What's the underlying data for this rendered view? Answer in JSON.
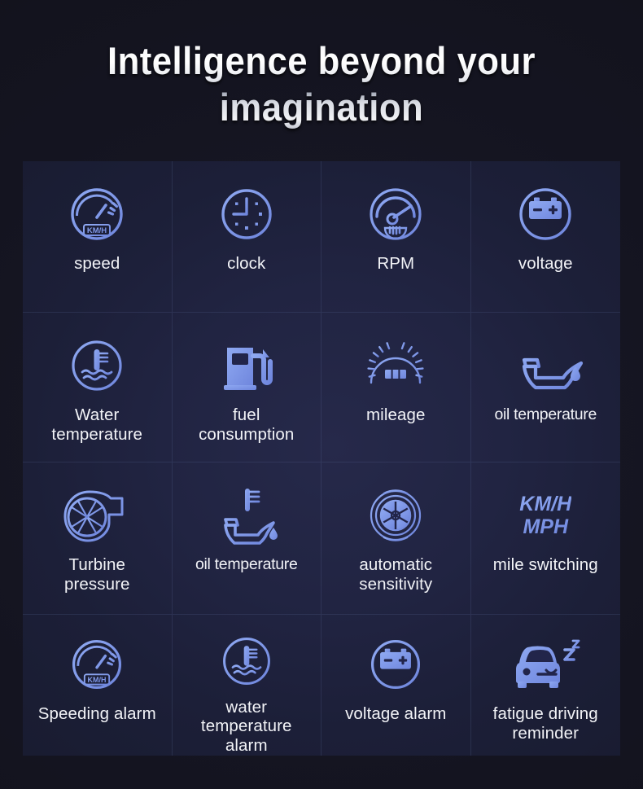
{
  "header": {
    "title": "Intelligence beyond your imagination"
  },
  "colors": {
    "page_background": "#13131d",
    "grid_background": "#222543",
    "icon_gradient_start": "#8fa9f2",
    "icon_gradient_end": "#6f86dd",
    "label_text": "#f2f3f7",
    "divider": "#5a659a"
  },
  "features": [
    {
      "label": "speed",
      "icon": "speedometer-kmh-icon"
    },
    {
      "label": "clock",
      "icon": "clock-icon"
    },
    {
      "label": "RPM",
      "icon": "rpm-gauge-icon"
    },
    {
      "label": "voltage",
      "icon": "battery-icon"
    },
    {
      "label": "Water\ntemperature",
      "icon": "water-temperature-icon"
    },
    {
      "label": "fuel\nconsumption",
      "icon": "fuel-pump-icon"
    },
    {
      "label": "mileage",
      "icon": "odometer-icon"
    },
    {
      "label": "oil temperature",
      "icon": "oil-can-icon"
    },
    {
      "label": "Turbine\npressure",
      "icon": "turbocharger-icon"
    },
    {
      "label": "oil temperature",
      "icon": "oil-can-thermometer-icon"
    },
    {
      "label": "automatic\nsensitivity",
      "icon": "aperture-icon"
    },
    {
      "label": "mile switching",
      "icon": "kmh-mph-text-icon",
      "icon_text": "KM/H\nMPH"
    },
    {
      "label": "Speeding alarm",
      "icon": "speedometer-kmh-icon"
    },
    {
      "label": "water\ntemperature\nalarm",
      "icon": "water-temperature-icon"
    },
    {
      "label": "voltage alarm",
      "icon": "battery-icon"
    },
    {
      "label": "fatigue driving\nreminder",
      "icon": "sleeping-car-icon"
    }
  ]
}
